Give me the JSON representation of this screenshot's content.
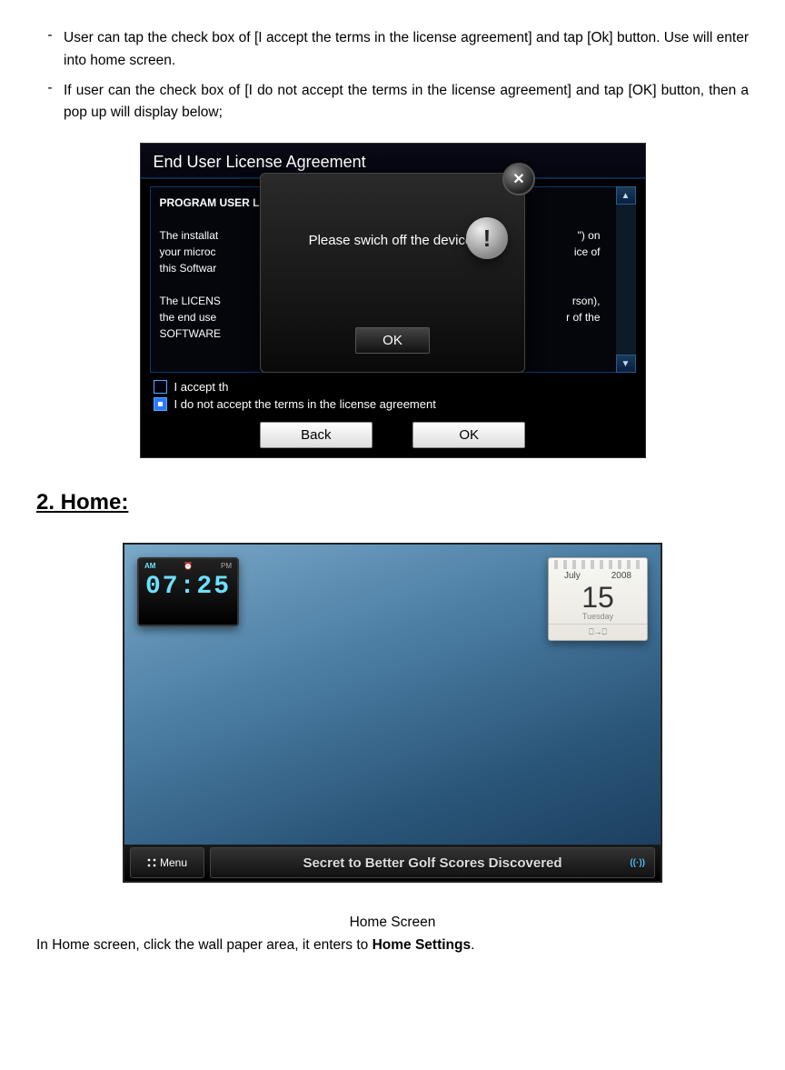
{
  "bullets": [
    "User can tap the check box of [I accept the terms in the license agreement] and tap [Ok] button. Use will enter into home screen.",
    "If user can the check box of [I do not accept the terms in the license agreement] and tap [OK] button, then a pop up will display below;"
  ],
  "eula": {
    "title": "End User License Agreement",
    "heading": "PROGRAM USER LICENSE AGREEMENT",
    "para1a": "The installat",
    "para1b": "\") on",
    "para2a": "your microc",
    "para2b": "ice of",
    "para3": "this Softwar",
    "para4a": "The LICENS",
    "para4b": "rson),",
    "para5a": "the end use",
    "para5b": "r of the",
    "para6": "SOFTWARE",
    "accept_label": "I  accept th",
    "decline_label": "I do not accept the terms in the license agreement",
    "back": "Back",
    "ok": "OK",
    "popup": {
      "text": "Please swich off the device!",
      "ok": "OK"
    }
  },
  "section2": "2. Home:",
  "home": {
    "clock": {
      "am": "AM",
      "pm": "PM",
      "time": "07:25"
    },
    "calendar": {
      "month": "July",
      "year": "2008",
      "day": "15",
      "weekday": "Tuesday",
      "toggle": "⎕→⎕"
    },
    "menu": "Menu",
    "ticker": "Secret to Better Golf Scores Discovered",
    "ticker_ind": "((·))"
  },
  "caption": "Home Screen",
  "closing_prefix": "In Home screen, click the wall paper area, it enters to ",
  "closing_bold": "Home Settings",
  "closing_suffix": "."
}
